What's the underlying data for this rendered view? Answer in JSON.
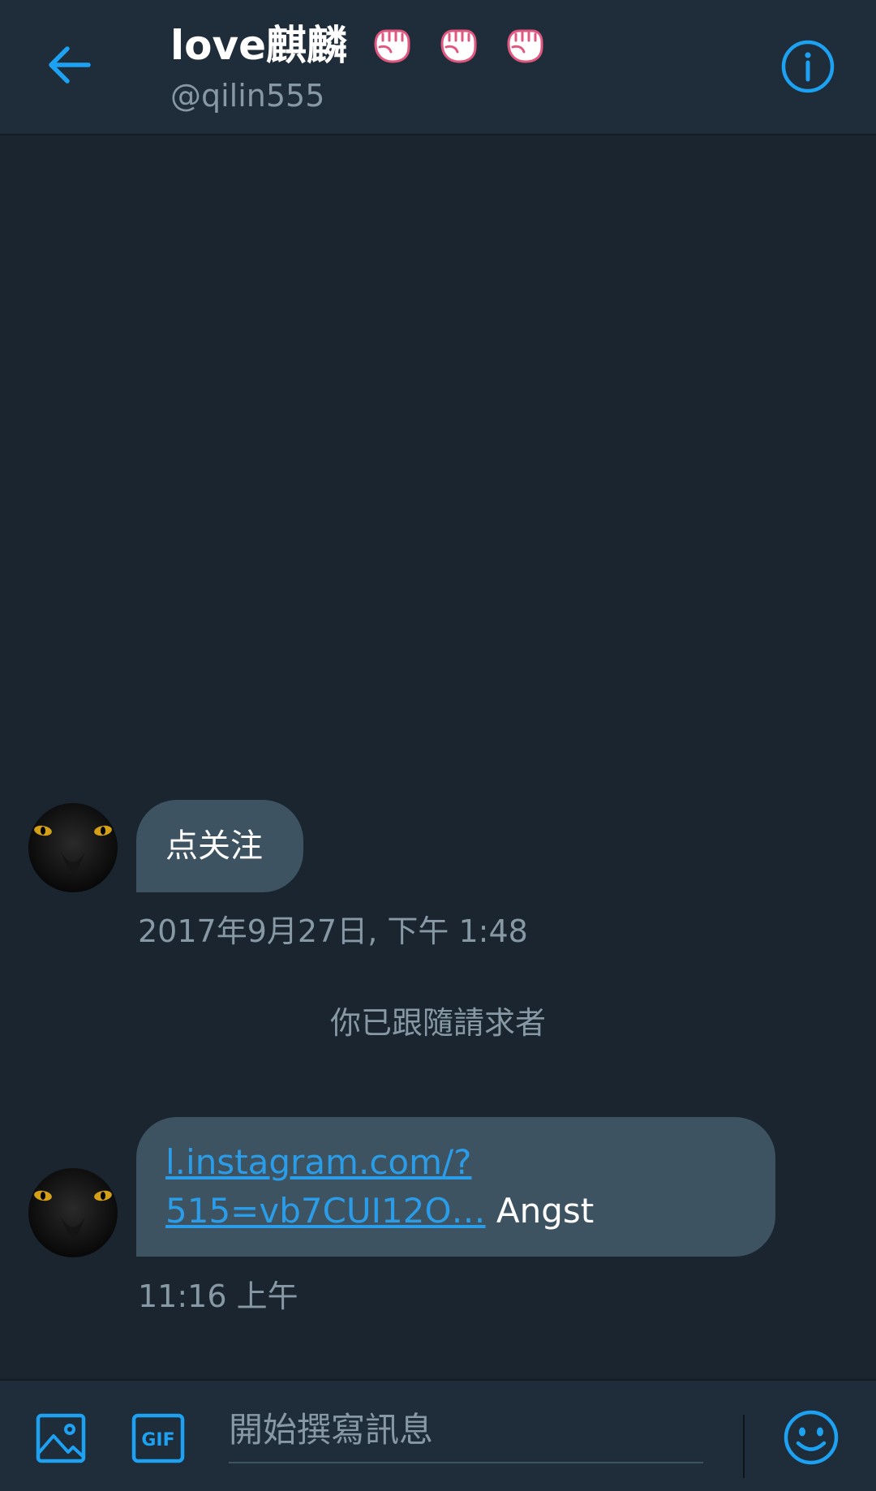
{
  "header": {
    "title": "love麒麟",
    "handle": "@qilin555",
    "title_emoji_count": 3,
    "icons": [
      "back-arrow-icon",
      "raised-fist-icon",
      "info-icon"
    ]
  },
  "messages": [
    {
      "text": "点关注",
      "timestamp": "2017年9月27日, 下午 1:48"
    },
    {
      "link_line1": "l.instagram.com/?",
      "link_line2": "515=vb7CUI12O…",
      "text_after": " Angst",
      "timestamp": "11:16 上午"
    }
  ],
  "system_message": "你已跟隨請求者",
  "composer": {
    "placeholder": "開始撰寫訊息",
    "icons": [
      "image-icon",
      "gif-icon",
      "emoji-icon"
    ],
    "gif_label": "GIF"
  },
  "colors": {
    "accent": "#1da1f2",
    "header_bg": "#1f2c3a",
    "chat_bg": "#1a2530",
    "bubble_bg": "#3d5361",
    "muted_text": "#8899a6",
    "emoji_pink": "#e0577f"
  }
}
